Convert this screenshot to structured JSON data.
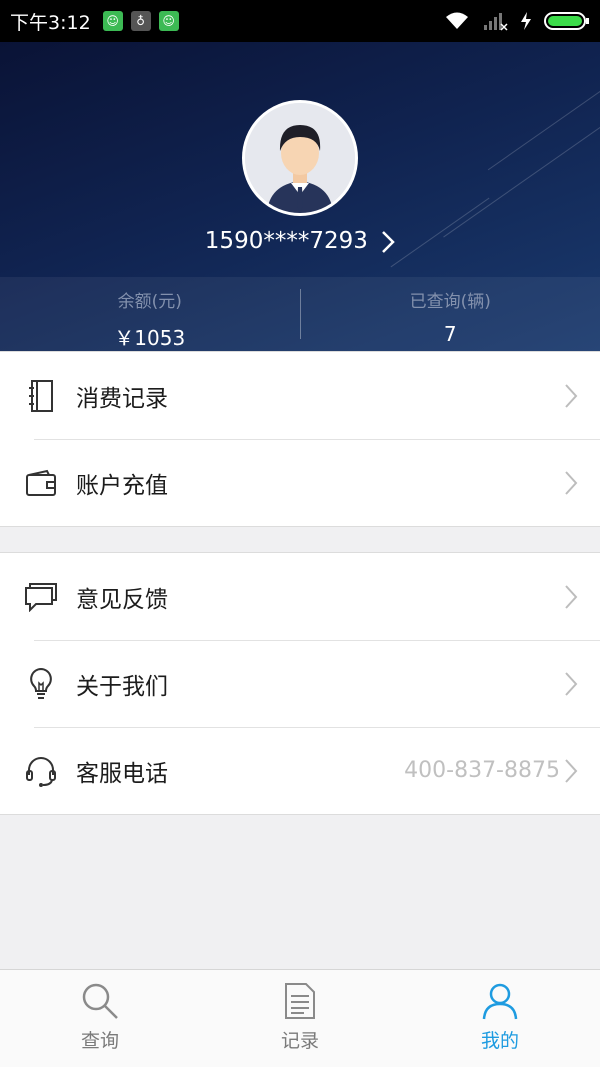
{
  "status_bar": {
    "time": "下午3:12",
    "badge_colors": [
      "#3cba54",
      "#555555",
      "#3cba54"
    ]
  },
  "profile": {
    "phone": "1590****7293",
    "balance_label": "余额(元)",
    "balance_value": "￥1053",
    "queried_label": "已查询(辆)",
    "queried_value": "7"
  },
  "menu": {
    "group1": [
      {
        "label": "消费记录",
        "icon": "notebook-icon"
      },
      {
        "label": "账户充值",
        "icon": "wallet-icon"
      }
    ],
    "group2": [
      {
        "label": "意见反馈",
        "icon": "chat-bubbles-icon"
      },
      {
        "label": "关于我们",
        "icon": "lightbulb-icon"
      },
      {
        "label": "客服电话",
        "icon": "headset-icon",
        "value": "400-837-8875"
      }
    ]
  },
  "tabbar": {
    "tabs": [
      {
        "label": "查询",
        "icon": "search-icon",
        "active": false
      },
      {
        "label": "记录",
        "icon": "document-icon",
        "active": false
      },
      {
        "label": "我的",
        "icon": "user-icon",
        "active": true
      }
    ],
    "active_color": "#1e9be0"
  }
}
